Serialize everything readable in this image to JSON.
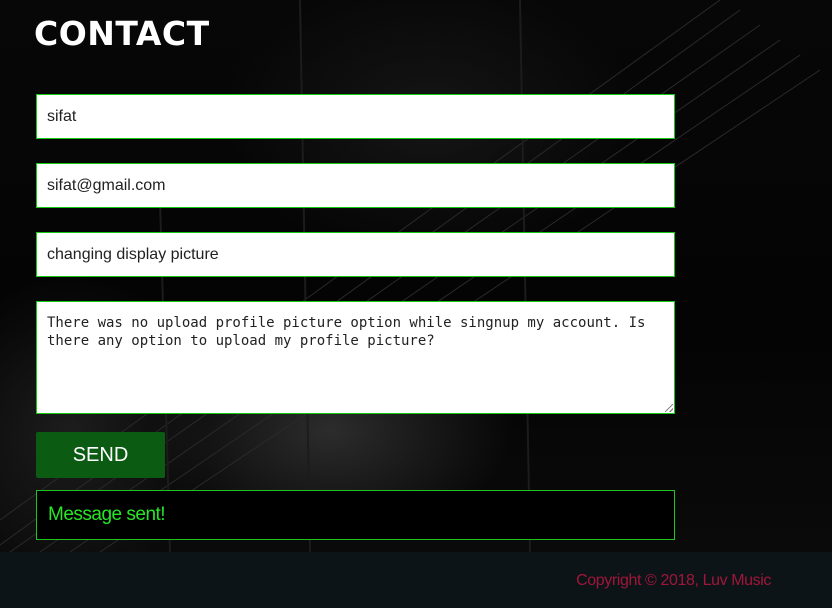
{
  "page": {
    "title": "CONTACT"
  },
  "form": {
    "name_value": "sifat",
    "email_value": "sifat@gmail.com",
    "subject_value": "changing display picture",
    "message_value": "There was no upload profile picture option while singnup my account. Is there any option to upload my profile picture?",
    "send_label": "SEND"
  },
  "status": {
    "message": "Message sent!"
  },
  "footer": {
    "copyright": "Copyright © 2018, Luv Music"
  },
  "colors": {
    "field_border": "#13c713",
    "send_button_bg": "#0b5c12",
    "status_text": "#27e627",
    "copyright_text": "#a0163a",
    "footer_bg": "#0d1418"
  }
}
